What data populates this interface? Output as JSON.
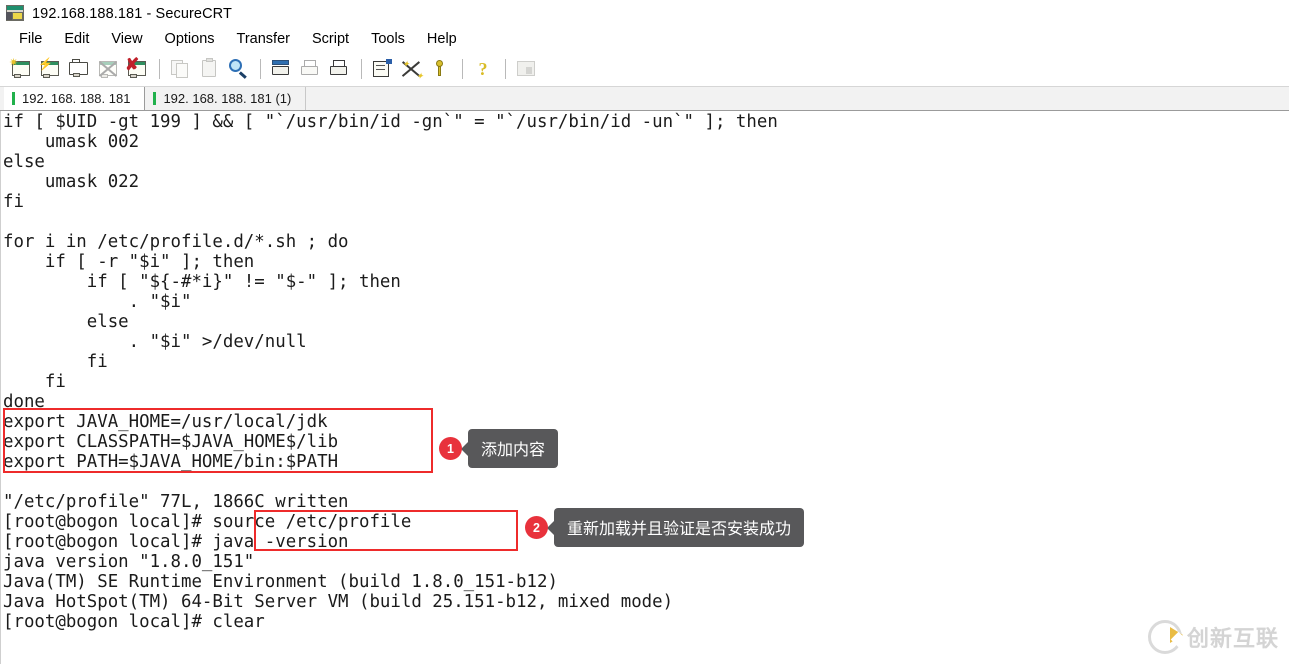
{
  "window": {
    "title": "192.168.188.181 - SecureCRT",
    "icon": "securecrt-app-icon"
  },
  "menu": {
    "items": [
      {
        "label": "File"
      },
      {
        "label": "Edit"
      },
      {
        "label": "View"
      },
      {
        "label": "Options"
      },
      {
        "label": "Transfer"
      },
      {
        "label": "Script"
      },
      {
        "label": "Tools"
      },
      {
        "label": "Help"
      }
    ]
  },
  "toolbar": {
    "buttons": [
      {
        "name": "new-session-icon",
        "tip": "New Session"
      },
      {
        "name": "quick-connect-icon",
        "tip": "Quick Connect"
      },
      {
        "name": "open-session-folder-icon",
        "tip": "Session Manager"
      },
      {
        "name": "reconnect-icon",
        "tip": "Reconnect"
      },
      {
        "name": "disconnect-icon",
        "tip": "Disconnect"
      },
      {
        "name": "copy-icon",
        "tip": "Copy"
      },
      {
        "name": "paste-icon",
        "tip": "Paste"
      },
      {
        "name": "find-icon",
        "tip": "Find"
      },
      {
        "name": "print-screen-icon",
        "tip": "Print Screen"
      },
      {
        "name": "log-session-icon",
        "tip": "Log Session"
      },
      {
        "name": "print-icon",
        "tip": "Print"
      },
      {
        "name": "session-options-icon",
        "tip": "Session Options"
      },
      {
        "name": "global-options-icon",
        "tip": "Global Options"
      },
      {
        "name": "key-icon",
        "tip": "Key"
      },
      {
        "name": "help-icon",
        "tip": "Help"
      },
      {
        "name": "last-icon",
        "tip": "Arrange"
      }
    ]
  },
  "tabs": [
    {
      "label": "192. 168. 188. 181",
      "active": true,
      "status_color": "#21b14c"
    },
    {
      "label": "192. 168. 188. 181  (1)",
      "active": false,
      "status_color": "#21b14c"
    }
  ],
  "terminal": {
    "text": "if [ $UID -gt 199 ] && [ \"`/usr/bin/id -gn`\" = \"`/usr/bin/id -un`\" ]; then\n    umask 002\nelse\n    umask 022\nfi\n\nfor i in /etc/profile.d/*.sh ; do\n    if [ -r \"$i\" ]; then\n        if [ \"${-#*i}\" != \"$-\" ]; then\n            . \"$i\"\n        else\n            . \"$i\" >/dev/null\n        fi\n    fi\ndone\nexport JAVA_HOME=/usr/local/jdk\nexport CLASSPATH=$JAVA_HOME$/lib\nexport PATH=$JAVA_HOME/bin:$PATH\n\n\"/etc/profile\" 77L, 1866C written\n[root@bogon local]# source /etc/profile\n[root@bogon local]# java -version\njava version \"1.8.0_151\"\nJava(TM) SE Runtime Environment (build 1.8.0_151-b12)\nJava HotSpot(TM) 64-Bit Server VM (build 25.151-b12, mixed mode)\n[root@bogon local]# clear"
  },
  "annotations": {
    "accent_red": "#ee2b2b",
    "badge_red": "#e8323c",
    "tip_gray": "#58585a",
    "items": [
      {
        "number": "1",
        "tip": "添加内容"
      },
      {
        "number": "2",
        "tip": "重新加载并且验证是否安装成功"
      }
    ]
  },
  "watermark": {
    "text": "创新互联",
    "logo": "cx-circle-logo"
  }
}
